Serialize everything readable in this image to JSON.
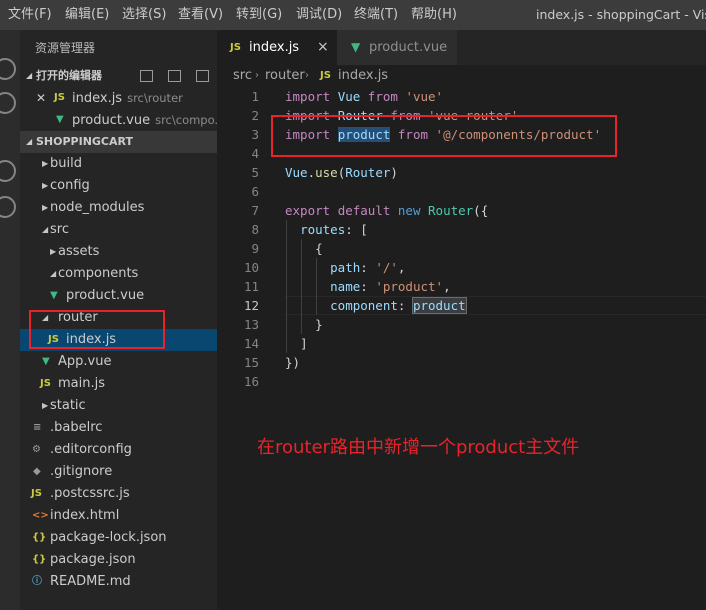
{
  "menu": [
    "文件(F)",
    "编辑(E)",
    "选择(S)",
    "查看(V)",
    "转到(G)",
    "调试(D)",
    "终端(T)",
    "帮助(H)"
  ],
  "window_title": "index.js - shoppingCart - Visual Studio Code",
  "sidebar": {
    "title": "资源管理器",
    "open_editors_label": "打开的编辑器",
    "open_editors": [
      {
        "name": "index.js",
        "path": "src\\router",
        "icon": "JS"
      },
      {
        "name": "product.vue",
        "path": "src\\compo...",
        "icon": "V"
      }
    ],
    "project_label": "SHOPPINGCART",
    "tree": [
      {
        "name": "build",
        "type": "folder"
      },
      {
        "name": "config",
        "type": "folder"
      },
      {
        "name": "node_modules",
        "type": "folder"
      },
      {
        "name": "src",
        "type": "folder-open"
      },
      {
        "name": "assets",
        "type": "folder"
      },
      {
        "name": "components",
        "type": "folder-open"
      },
      {
        "name": "product.vue",
        "type": "vue"
      },
      {
        "name": "router",
        "type": "folder-open"
      },
      {
        "name": "index.js",
        "type": "js"
      },
      {
        "name": "App.vue",
        "type": "vue"
      },
      {
        "name": "main.js",
        "type": "js"
      },
      {
        "name": "static",
        "type": "folder"
      },
      {
        "name": ".babelrc",
        "type": "config"
      },
      {
        "name": ".editorconfig",
        "type": "gear"
      },
      {
        "name": ".gitignore",
        "type": "config"
      },
      {
        "name": ".postcssrc.js",
        "type": "js"
      },
      {
        "name": "index.html",
        "type": "html"
      },
      {
        "name": "package-lock.json",
        "type": "json"
      },
      {
        "name": "package.json",
        "type": "json"
      },
      {
        "name": "README.md",
        "type": "info"
      }
    ]
  },
  "tabs": [
    {
      "label": "index.js",
      "icon": "JS",
      "close": "×"
    },
    {
      "label": "product.vue",
      "icon": "V"
    }
  ],
  "breadcrumb": [
    "src",
    "router",
    "index.js"
  ],
  "code": {
    "line_numbers": [
      "1",
      "2",
      "3",
      "4",
      "5",
      "6",
      "7",
      "8",
      "9",
      "10",
      "11",
      "12",
      "13",
      "14",
      "15",
      "16"
    ],
    "l1": {
      "kw": "import",
      "id": "Vue",
      "from": "from",
      "str": "'vue'"
    },
    "l2": {
      "kw": "import",
      "id": "Router",
      "from": "from",
      "str": "'vue-router'"
    },
    "l3": {
      "kw": "import",
      "id": "product",
      "from": "from",
      "str": "'@/components/product'"
    },
    "l5": {
      "obj": "Vue",
      "dot": ".",
      "fn": "use",
      "open": "(",
      "arg": "Router",
      "close": ")"
    },
    "l7": {
      "kw1": "export",
      "kw2": "default",
      "kw3": "new",
      "cls": "Router",
      "open": "({"
    },
    "l8": {
      "key": "routes",
      "rest": ": ["
    },
    "l9": {
      "brace": "{"
    },
    "l10": {
      "key": "path",
      "colon": ": ",
      "str": "'/'",
      "comma": ","
    },
    "l11": {
      "key": "name",
      "colon": ": ",
      "str": "'product'",
      "comma": ","
    },
    "l12": {
      "key": "component",
      "colon": ": ",
      "val": "product"
    },
    "l13": {
      "brace": "}"
    },
    "l14": {
      "bracket": "]"
    },
    "l15": {
      "close": "})"
    }
  },
  "annotation": "在router路由中新增一个product主文件",
  "colors": {
    "annotation_red": "#e8242a",
    "selection": "#094771",
    "keyword": "#569cd6",
    "string": "#ce9178"
  }
}
